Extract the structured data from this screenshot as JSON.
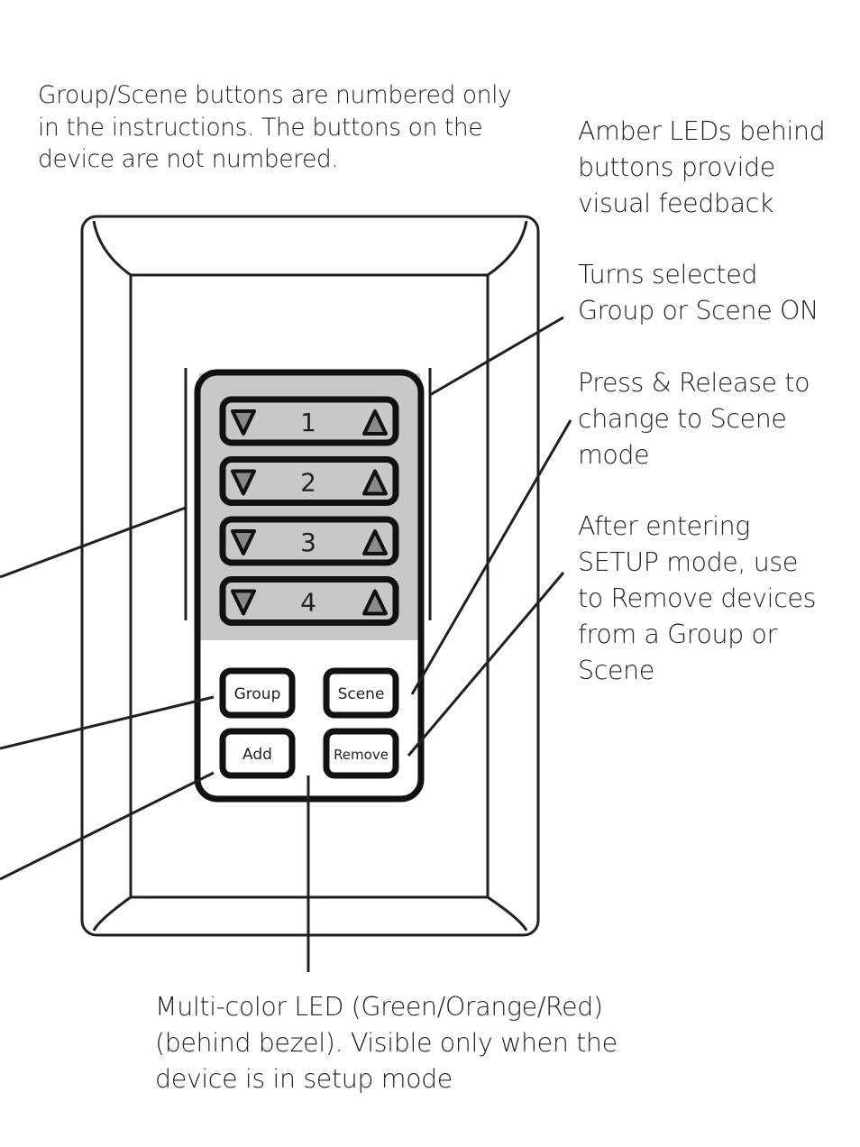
{
  "annotations": {
    "numbering_note": "Group/Scene buttons are numbered only\nin the instructions. The buttons on the\ndevice are not numbered.",
    "amber_leds": "Amber LEDs behind\nbuttons provide\nvisual feedback",
    "turns_on": "Turns selected\nGroup or Scene ON",
    "scene_mode": "Press & Release to\nchange to Scene\nmode",
    "remove": "After entering\nSETUP mode, use\nto Remove devices\nfrom a Group or\nScene",
    "multicolor_led": "Multi-color LED (Green/Orange/Red)\n(behind bezel).  Visible only when the\ndevice is in setup mode"
  },
  "device": {
    "rockers": [
      "1",
      "2",
      "3",
      "4"
    ],
    "buttons": {
      "group": "Group",
      "scene": "Scene",
      "add": "Add",
      "remove": "Remove"
    }
  },
  "colors": {
    "ink": "#231f20",
    "panel_gray": "#c8c8c8",
    "arrow_fill": "#8a8a8a"
  }
}
